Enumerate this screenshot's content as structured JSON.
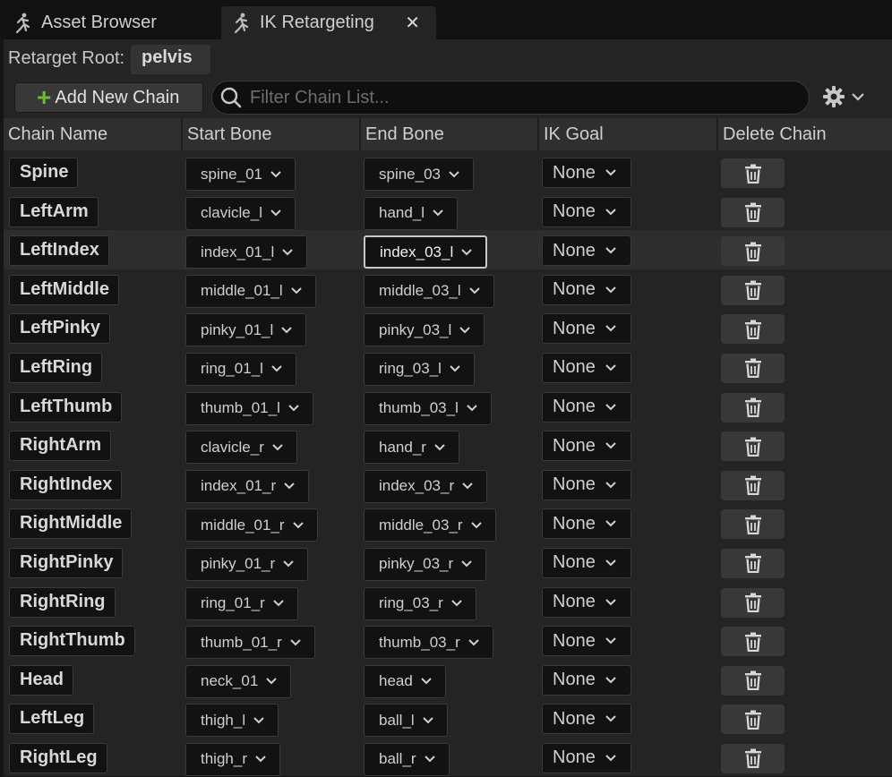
{
  "tabs": [
    {
      "label": "Asset Browser",
      "icon": "runner-icon"
    },
    {
      "label": "IK Retargeting",
      "icon": "runner-icon",
      "close_glyph": "✕"
    }
  ],
  "retarget_root": {
    "label": "Retarget Root:",
    "value": "pelvis"
  },
  "toolbar": {
    "add_chain_label": "Add New Chain",
    "search_placeholder": "Filter Chain List..."
  },
  "columns": [
    "Chain Name",
    "Start Bone",
    "End Bone",
    "IK Goal",
    "Delete Chain"
  ],
  "chains": [
    {
      "name": "Spine",
      "start": "spine_01",
      "end": "spine_03",
      "goal": "None"
    },
    {
      "name": "LeftArm",
      "start": "clavicle_l",
      "end": "hand_l",
      "goal": "None"
    },
    {
      "name": "LeftIndex",
      "start": "index_01_l",
      "end": "index_03_l",
      "goal": "None"
    },
    {
      "name": "LeftMiddle",
      "start": "middle_01_l",
      "end": "middle_03_l",
      "goal": "None"
    },
    {
      "name": "LeftPinky",
      "start": "pinky_01_l",
      "end": "pinky_03_l",
      "goal": "None"
    },
    {
      "name": "LeftRing",
      "start": "ring_01_l",
      "end": "ring_03_l",
      "goal": "None"
    },
    {
      "name": "LeftThumb",
      "start": "thumb_01_l",
      "end": "thumb_03_l",
      "goal": "None"
    },
    {
      "name": "RightArm",
      "start": "clavicle_r",
      "end": "hand_r",
      "goal": "None"
    },
    {
      "name": "RightIndex",
      "start": "index_01_r",
      "end": "index_03_r",
      "goal": "None"
    },
    {
      "name": "RightMiddle",
      "start": "middle_01_r",
      "end": "middle_03_r",
      "goal": "None"
    },
    {
      "name": "RightPinky",
      "start": "pinky_01_r",
      "end": "pinky_03_r",
      "goal": "None"
    },
    {
      "name": "RightRing",
      "start": "ring_01_r",
      "end": "ring_03_r",
      "goal": "None"
    },
    {
      "name": "RightThumb",
      "start": "thumb_01_r",
      "end": "thumb_03_r",
      "goal": "None"
    },
    {
      "name": "Head",
      "start": "neck_01",
      "end": "head",
      "goal": "None"
    },
    {
      "name": "LeftLeg",
      "start": "thigh_l",
      "end": "ball_l",
      "goal": "None"
    },
    {
      "name": "RightLeg",
      "start": "thigh_r",
      "end": "ball_r",
      "goal": "None"
    }
  ],
  "selected_row_name": "LeftIndex",
  "colors": {
    "accent_plus": "#6bbd2e",
    "panel": "#242424",
    "field": "#121212"
  }
}
